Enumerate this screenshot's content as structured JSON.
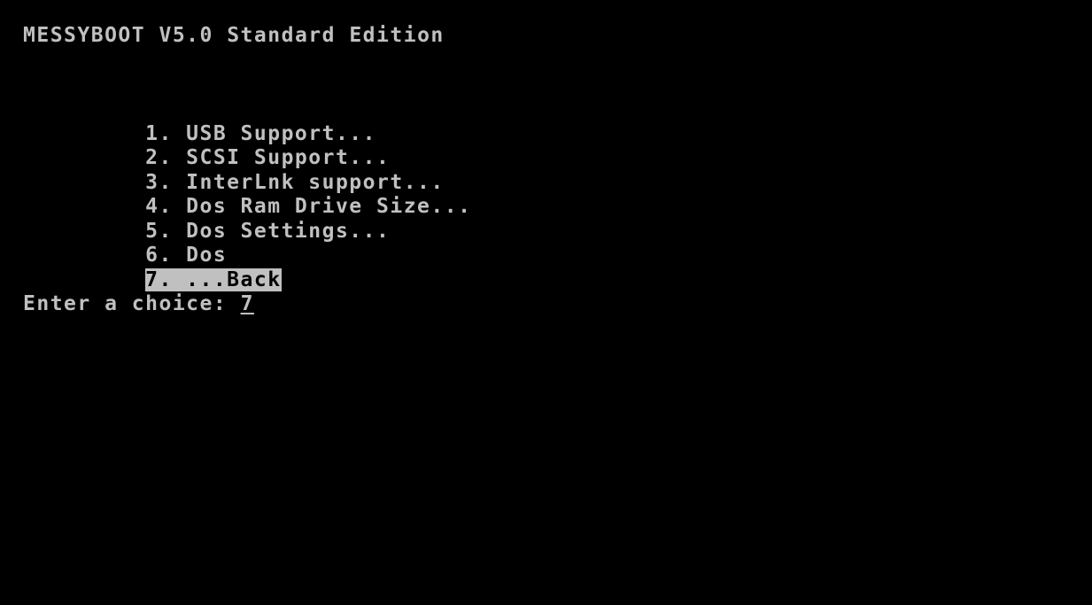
{
  "title": "MESSYBOOT V5.0 Standard Edition",
  "menu": {
    "items": [
      {
        "text": "1. USB Support..."
      },
      {
        "text": "2. SCSI Support..."
      },
      {
        "text": "3. InterLnk support..."
      },
      {
        "text": "4. Dos Ram Drive Size..."
      },
      {
        "text": "5. Dos Settings..."
      },
      {
        "text": "6. Dos"
      },
      {
        "text": "7. ...Back"
      }
    ],
    "selected_index": 6
  },
  "prompt": {
    "label": "Enter a choice: ",
    "value": "7"
  },
  "colors": {
    "background": "#000000",
    "text": "#c0c0c0",
    "highlight_bg": "#c0c0c0",
    "highlight_text": "#000000"
  }
}
